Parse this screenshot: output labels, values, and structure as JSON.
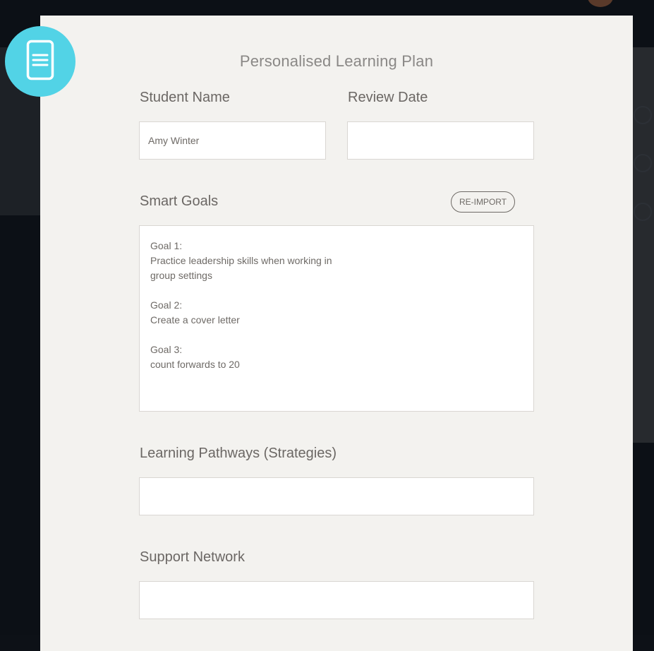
{
  "form": {
    "title": "Personalised Learning Plan",
    "student_name": {
      "label": "Student Name",
      "value": "Amy Winter"
    },
    "review_date": {
      "label": "Review Date",
      "value": ""
    },
    "smart_goals": {
      "label": "Smart Goals",
      "reimport_label": "RE-IMPORT",
      "value": "Goal 1:\nPractice leadership skills when working in\ngroup settings\n\nGoal 2:\nCreate a cover letter\n\nGoal 3:\ncount forwards to 20"
    },
    "learning_pathways": {
      "label": "Learning Pathways (Strategies)",
      "value": ""
    },
    "support_network": {
      "label": "Support Network",
      "value": ""
    }
  },
  "colors": {
    "accent": "#52d3e6",
    "modal_bg": "#f3f2ef",
    "backdrop": "#0c1016"
  },
  "icons": {
    "badge": "document-icon"
  }
}
